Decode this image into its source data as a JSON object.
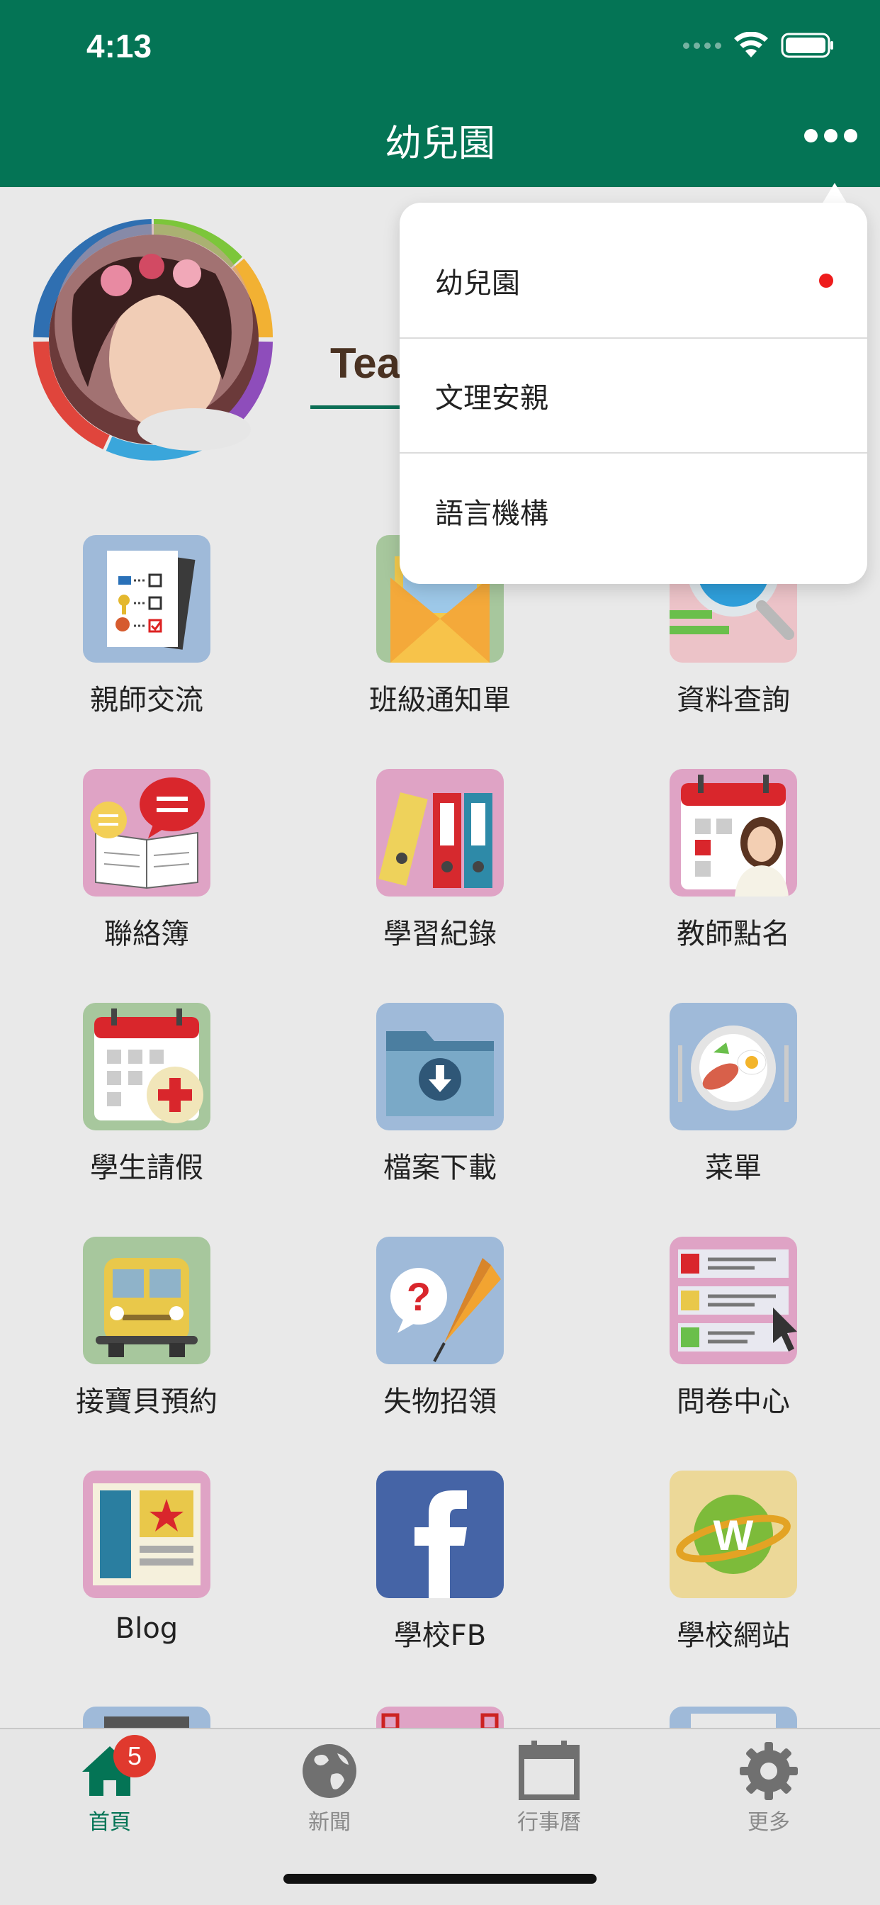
{
  "status_bar": {
    "time": "4:13"
  },
  "header": {
    "title": "幼兒園"
  },
  "profile": {
    "name_partial": "Tea"
  },
  "dropdown": {
    "items": [
      {
        "label": "幼兒園",
        "selected": true
      },
      {
        "label": "文理安親",
        "selected": false
      },
      {
        "label": "語言機構",
        "selected": false
      }
    ]
  },
  "grid": {
    "items": [
      {
        "label": "親師交流",
        "icon": "checklist-icon"
      },
      {
        "label": "班級通知單",
        "icon": "envelope-icon"
      },
      {
        "label": "資料查詢",
        "icon": "magnifier-icon"
      },
      {
        "label": "聯絡簿",
        "icon": "notebook-chat-icon"
      },
      {
        "label": "學習紀錄",
        "icon": "binders-icon"
      },
      {
        "label": "教師點名",
        "icon": "calendar-teacher-icon"
      },
      {
        "label": "學生請假",
        "icon": "calendar-plus-icon"
      },
      {
        "label": "檔案下載",
        "icon": "download-folder-icon"
      },
      {
        "label": "菜單",
        "icon": "meal-plate-icon"
      },
      {
        "label": "接寶貝預約",
        "icon": "school-bus-icon"
      },
      {
        "label": "失物招領",
        "icon": "umbrella-question-icon"
      },
      {
        "label": "問卷中心",
        "icon": "survey-icon"
      },
      {
        "label": "Blog",
        "icon": "blog-icon"
      },
      {
        "label": "學校FB",
        "icon": "facebook-icon"
      },
      {
        "label": "學校網站",
        "icon": "website-globe-icon"
      }
    ]
  },
  "tabbar": {
    "items": [
      {
        "label": "首頁",
        "icon": "home-icon",
        "active": true,
        "badge": "5"
      },
      {
        "label": "新聞",
        "icon": "globe-icon",
        "active": false
      },
      {
        "label": "行事曆",
        "icon": "calendar-icon",
        "active": false
      },
      {
        "label": "更多",
        "icon": "gear-icon",
        "active": false
      }
    ]
  },
  "colors": {
    "header_bg": "#047455",
    "page_bg": "#e9e9e9",
    "badge": "#e0392e",
    "selected_dot": "#ee1c1c"
  }
}
